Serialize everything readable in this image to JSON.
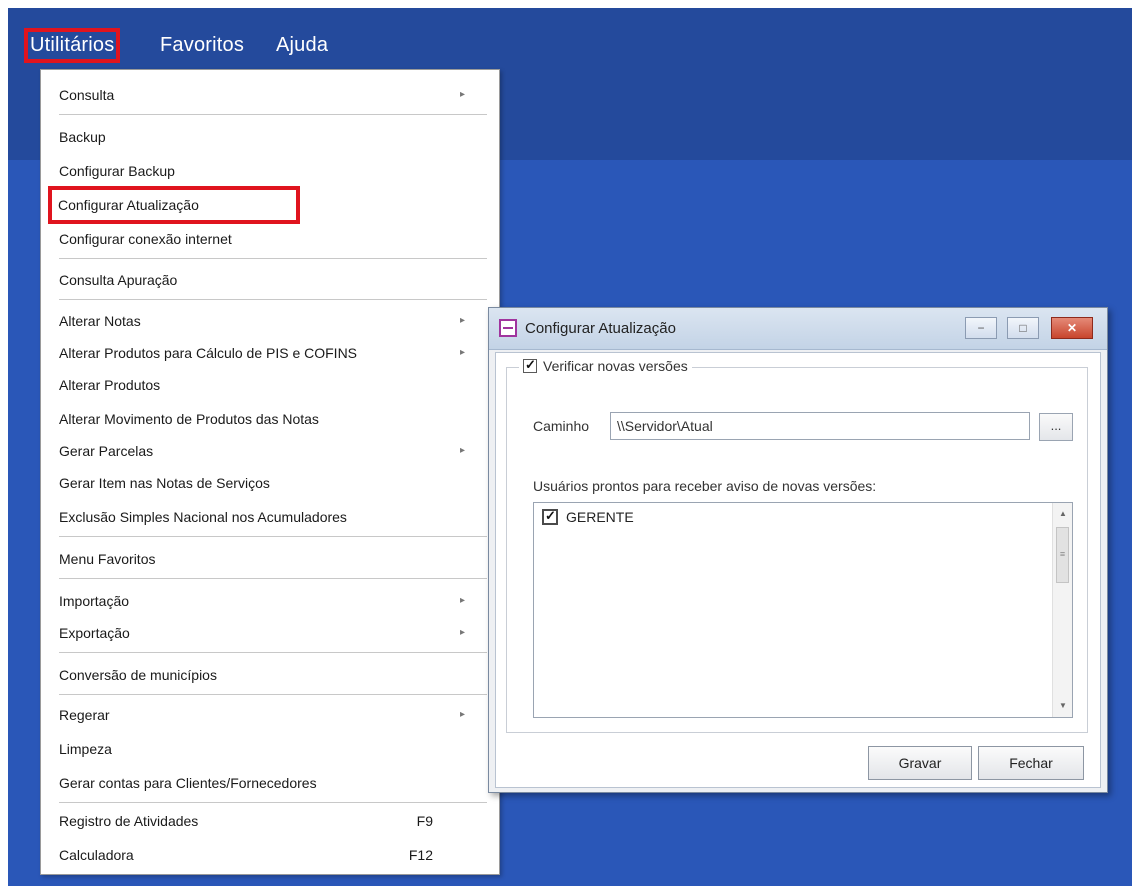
{
  "menubar": {
    "items": [
      {
        "label": "Utilitários"
      },
      {
        "label": "Favoritos"
      },
      {
        "label": "Ajuda"
      }
    ]
  },
  "menu": {
    "items": [
      {
        "label": "Consulta",
        "submenu": true
      },
      {
        "label": "Backup"
      },
      {
        "label": "Configurar Backup"
      },
      {
        "label": "Configurar Atualização",
        "highlighted": true
      },
      {
        "label": "Configurar conexão internet"
      },
      {
        "label": "Consulta Apuração"
      },
      {
        "label": "Alterar Notas",
        "submenu": true
      },
      {
        "label": "Alterar Produtos para Cálculo de PIS e COFINS",
        "submenu": true
      },
      {
        "label": "Alterar Produtos"
      },
      {
        "label": "Alterar Movimento de Produtos das Notas"
      },
      {
        "label": "Gerar Parcelas",
        "submenu": true
      },
      {
        "label": "Gerar Item nas Notas de Serviços"
      },
      {
        "label": "Exclusão Simples Nacional nos Acumuladores"
      },
      {
        "label": "Menu Favoritos"
      },
      {
        "label": "Importação",
        "submenu": true
      },
      {
        "label": "Exportação",
        "submenu": true
      },
      {
        "label": "Conversão de municípios"
      },
      {
        "label": "Regerar",
        "submenu": true
      },
      {
        "label": "Limpeza"
      },
      {
        "label": "Gerar contas para Clientes/Fornecedores"
      },
      {
        "label": "Registro de Atividades",
        "shortcut": "F9"
      },
      {
        "label": "Calculadora",
        "shortcut": "F12"
      }
    ]
  },
  "dialog": {
    "title": "Configurar Atualização",
    "group_label": "Verificar novas versões",
    "group_checked": true,
    "path_label": "Caminho",
    "path_value": "\\\\Servidor\\Atual",
    "browse_label": "...",
    "users_label": "Usuários prontos para receber aviso de novas versões:",
    "users": [
      {
        "name": "GERENTE",
        "checked": true
      }
    ],
    "save_label": "Gravar",
    "close_label": "Fechar",
    "window_buttons": {
      "minimize": "−",
      "maximize": "□",
      "close": "✕"
    }
  }
}
